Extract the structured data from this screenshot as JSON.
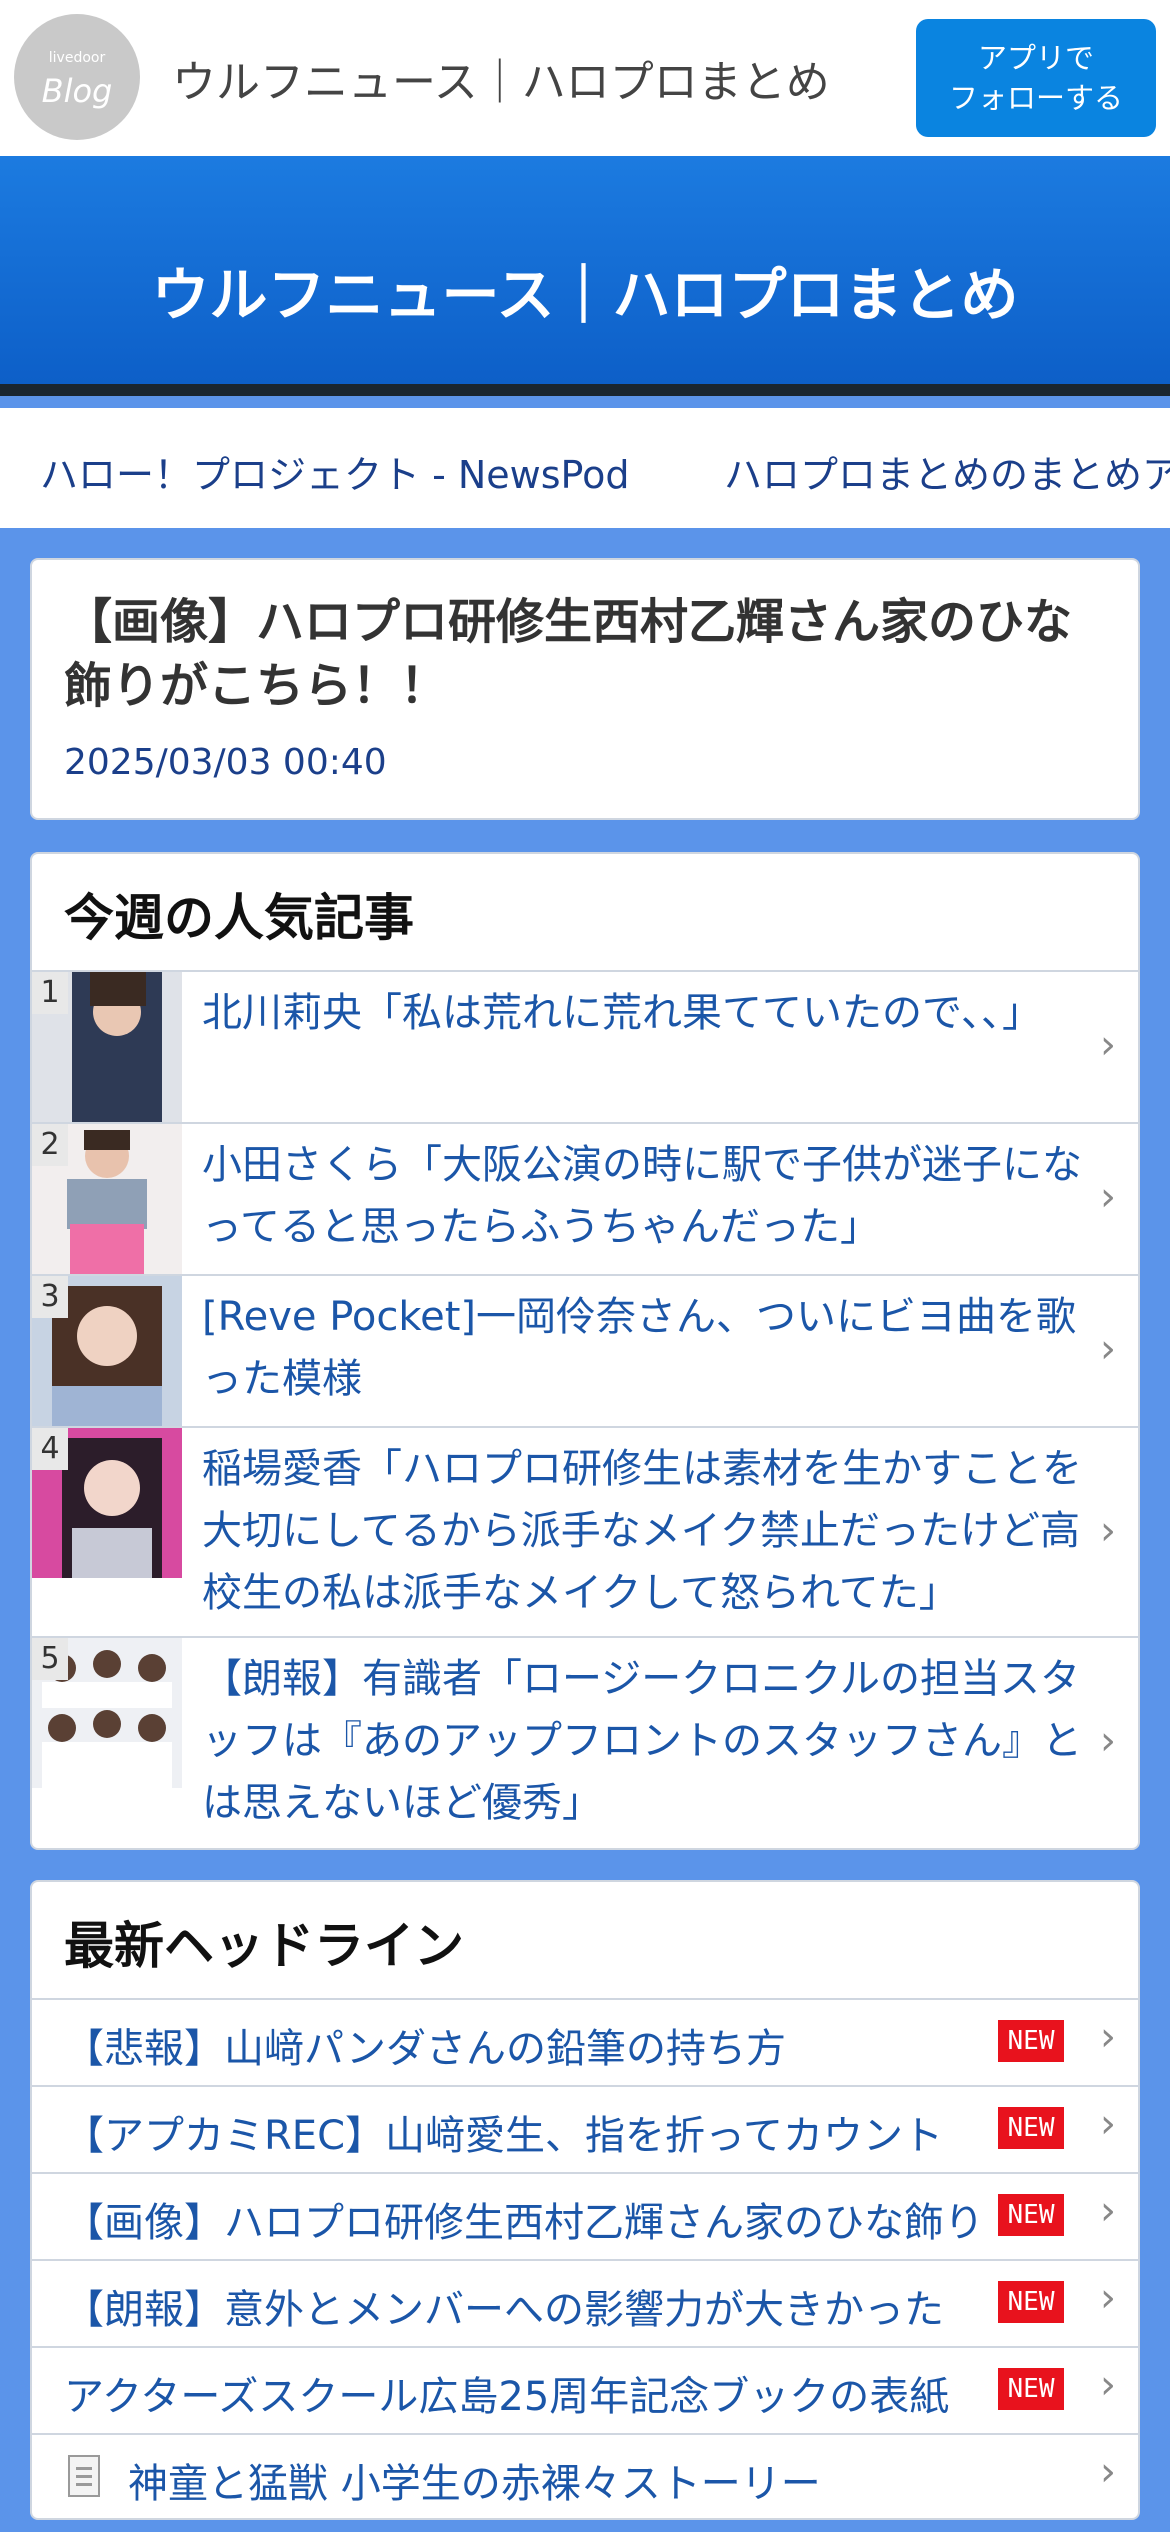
{
  "header": {
    "logo_small": "livedoor",
    "logo_big": "Blog",
    "site_name": "ウルフニュース｜ハロプロまとめ",
    "follow_line1": "アプリで",
    "follow_line2": "フォローする"
  },
  "hero": {
    "title": "ウルフニュース｜ハロプロまとめ"
  },
  "nav": {
    "links": [
      "ハロー！プロジェクト - NewsPod",
      "ハロプロまとめのまとめア"
    ]
  },
  "article": {
    "title": "【画像】ハロプロ研修生西村乙輝さん家のひな飾りがこちら！！",
    "date": "2025/03/03 00:40"
  },
  "popular": {
    "title": "今週の人気記事",
    "items": [
      {
        "rank": "1",
        "text": "北川莉央「私は荒れに荒れ果てていたので､､」"
      },
      {
        "rank": "2",
        "text": "小田さくら「大阪公演の時に駅で子供が迷子になってると思ったらふうちゃんだった」"
      },
      {
        "rank": "3",
        "text": "[Reve Pocket]一岡伶奈さん、ついにビヨ曲を歌った模様"
      },
      {
        "rank": "4",
        "text": "稲場愛香「ハロプロ研修生は素材を生かすことを大切にしてるから派手なメイク禁止だったけど高校生の私は派手なメイクして怒られてた」"
      },
      {
        "rank": "5",
        "text": "【朗報】有識者「ロージークロニクルの担当スタッフは『あのアップフロントのスタッフさん』とは思えないほど優秀」"
      }
    ]
  },
  "headlines": {
    "title": "最新ヘッドライン",
    "new_label": "NEW",
    "items": [
      {
        "text": "【悲報】山﨑パンダさんの鉛筆の持ち方"
      },
      {
        "text": "【アプカミREC】山﨑愛生、指を折ってカウント"
      },
      {
        "text": "【画像】ハロプロ研修生西村乙輝さん家のひな飾り"
      },
      {
        "text": "【朗報】意外とメンバーへの影響力が大きかった"
      },
      {
        "text": "アクターズスクール広島25周年記念ブックの表紙"
      },
      {
        "text": "神童と猛獣 小学生の赤裸々ストーリー"
      }
    ]
  },
  "colors": {
    "page_background": "#5b94ea",
    "accent_blue": "#0a84e0",
    "link_blue": "#1b56a8",
    "new_badge_red": "#e8121d"
  }
}
